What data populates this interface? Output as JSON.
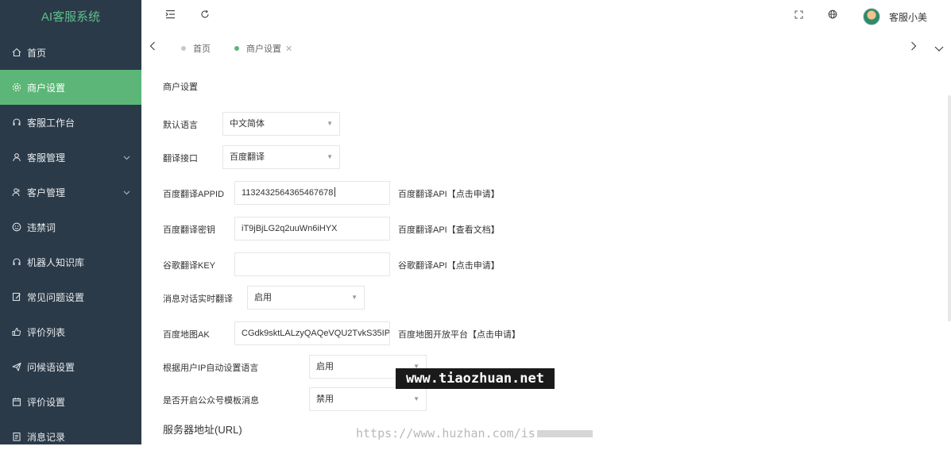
{
  "sidebar": {
    "brand": "AI客服系统",
    "items": [
      {
        "label": "首页",
        "icon": "home-icon"
      },
      {
        "label": "商户设置",
        "icon": "gear-icon",
        "active": true
      },
      {
        "label": "客服工作台",
        "icon": "headset-icon"
      },
      {
        "label": "客服管理",
        "icon": "user-icon",
        "expandable": true
      },
      {
        "label": "客户管理",
        "icon": "users-icon",
        "expandable": true
      },
      {
        "label": "违禁词",
        "icon": "smiley-icon"
      },
      {
        "label": "机器人知识库",
        "icon": "robot-icon"
      },
      {
        "label": "常见问题设置",
        "icon": "edit-icon"
      },
      {
        "label": "评价列表",
        "icon": "thumb-up-icon"
      },
      {
        "label": "问候语设置",
        "icon": "send-icon"
      },
      {
        "label": "评价设置",
        "icon": "calendar-icon"
      },
      {
        "label": "消息记录",
        "icon": "document-icon"
      }
    ]
  },
  "header": {
    "user_name": "客服小美"
  },
  "tabs": {
    "items": [
      {
        "label": "首页"
      },
      {
        "label": "商户设置",
        "active": true
      }
    ]
  },
  "form": {
    "section_title": "商户设置",
    "default_language": {
      "label": "默认语言",
      "value": "中文简体"
    },
    "translate_api": {
      "label": "翻译接口",
      "value": "百度翻译"
    },
    "baidu_appid": {
      "label": "百度翻译APPID",
      "value": "1132432564365467678",
      "help": "百度翻译API【点击申请】"
    },
    "baidu_secret": {
      "label": "百度翻译密钥",
      "value": "iT9jBjLG2q2uuWn6iHYX",
      "help": "百度翻译API【查看文档】"
    },
    "google_key": {
      "label": "谷歌翻译KEY",
      "value": "",
      "help": "谷歌翻译API【点击申请】"
    },
    "realtime_translate": {
      "label": "消息对话实时翻译",
      "value": "启用"
    },
    "baidu_map_ak": {
      "label": "百度地图AK",
      "value": "CGdk9sktLALzyQAQeVQU2TvkS35IP",
      "help": "百度地图开放平台【点击申请】"
    },
    "ip_auto_lang": {
      "label": "根据用户IP自动设置语言",
      "value": "启用"
    },
    "wechat_template": {
      "label": "是否开启公众号模板消息",
      "value": "禁用"
    },
    "server_url": {
      "label": "服务器地址(URL)"
    }
  },
  "watermarks": {
    "box": "www.tiaozhuan.net",
    "text": "https://www.huzhan.com/is"
  }
}
